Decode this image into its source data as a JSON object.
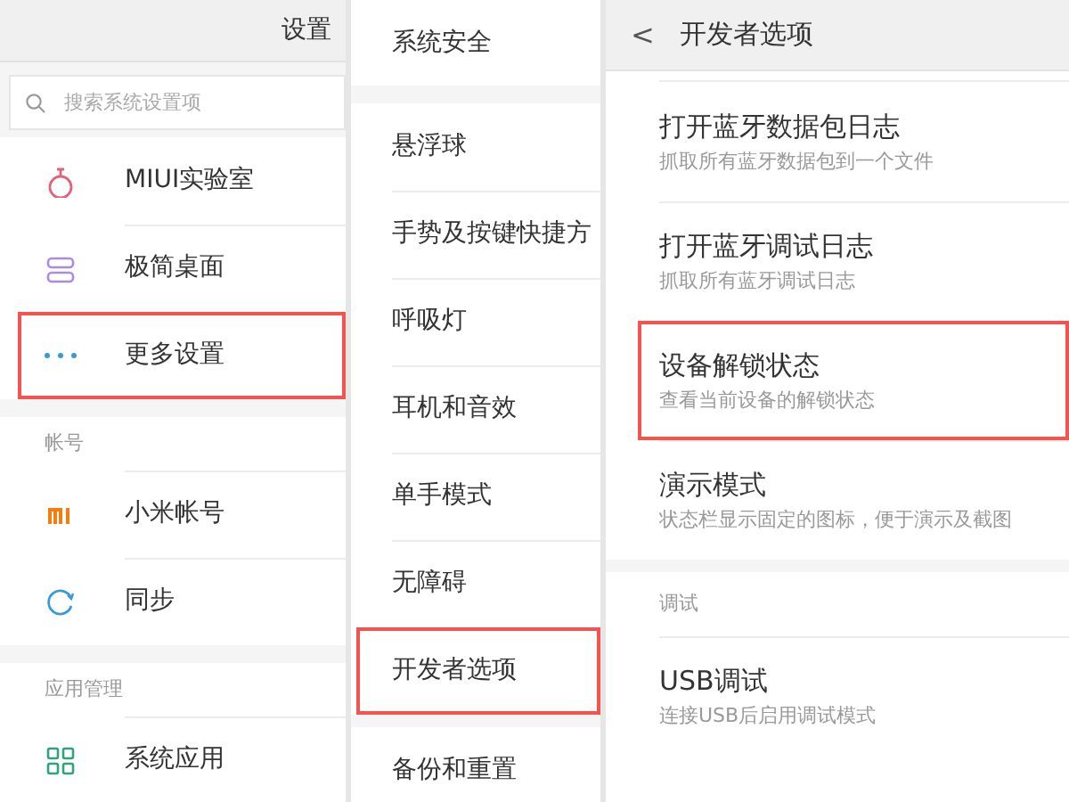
{
  "settings_panel": {
    "title": "设置",
    "search": {
      "placeholder": "搜索系统设置项"
    },
    "groups": [
      {
        "items": [
          {
            "title": "MIUI实验室",
            "highlighted": false
          },
          {
            "title": "极简桌面",
            "highlighted": false
          },
          {
            "title": "更多设置",
            "highlighted": true
          }
        ]
      },
      {
        "header": "帐号",
        "items": [
          {
            "title": "小米帐号",
            "highlighted": false
          },
          {
            "title": "同步",
            "highlighted": false
          }
        ]
      },
      {
        "header": "应用管理",
        "items": [
          {
            "title": "系统应用",
            "highlighted": false
          }
        ]
      }
    ]
  },
  "more_settings_panel": {
    "groups": [
      {
        "items": [
          {
            "title": "系统安全",
            "highlighted": false
          }
        ]
      },
      {
        "items": [
          {
            "title": "悬浮球",
            "highlighted": false
          },
          {
            "title": "手势及按键快捷方",
            "highlighted": false
          },
          {
            "title": "呼吸灯",
            "highlighted": false
          },
          {
            "title": "耳机和音效",
            "highlighted": false
          },
          {
            "title": "单手模式",
            "highlighted": false
          },
          {
            "title": "无障碍",
            "highlighted": false
          },
          {
            "title": "开发者选项",
            "highlighted": true
          }
        ]
      },
      {
        "items": [
          {
            "title": "备份和重置",
            "highlighted": false
          }
        ]
      }
    ]
  },
  "developer_panel": {
    "back": "<",
    "title": "开发者选项",
    "groups": [
      {
        "items": [
          {
            "title": "打开蓝牙数据包日志",
            "subtitle": "抓取所有蓝牙数据包到一个文件",
            "highlighted": false
          },
          {
            "title": "打开蓝牙调试日志",
            "subtitle": "抓取所有蓝牙调试日志",
            "highlighted": false
          },
          {
            "title": "设备解锁状态",
            "subtitle": "查看当前设备的解锁状态",
            "highlighted": true
          },
          {
            "title": "演示模式",
            "subtitle": "状态栏显示固定的图标，便于演示及截图",
            "highlighted": false
          }
        ]
      },
      {
        "header": "调试",
        "items": [
          {
            "title": "USB调试",
            "subtitle": "连接USB后启用调试模式",
            "highlighted": false
          }
        ]
      }
    ]
  }
}
